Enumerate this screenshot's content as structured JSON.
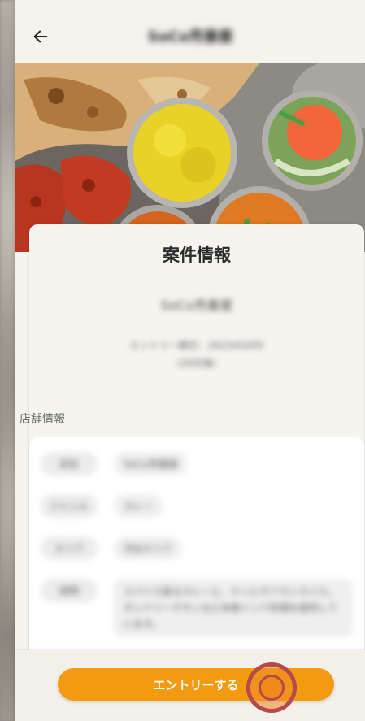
{
  "header": {
    "title": "SoCo売番屋"
  },
  "hero": {
    "image_icon": "food-photo-icon"
  },
  "project": {
    "heading": "案件情報",
    "shop_name": "SoCo売番屋",
    "description_line1": "エントリー期日：2023/03/05",
    "description_line2": "（20日後）"
  },
  "store_info": {
    "section_label": "店舗情報",
    "rows": [
      {
        "key": "店名",
        "value": "SoCo売番屋"
      },
      {
        "key": "ジャンル",
        "value": "カレー"
      },
      {
        "key": "エリア",
        "value": "渋谷エリア"
      },
      {
        "key": "説明",
        "value": "スパイス香るカレーと、ナンとサフランライス。タンドリーチキンなど本格インド料理を提供しています。"
      }
    ]
  },
  "footer": {
    "entry_label": "エントリーする"
  },
  "colors": {
    "accent": "#f39a10",
    "tap_ring": "#b54a4a"
  }
}
